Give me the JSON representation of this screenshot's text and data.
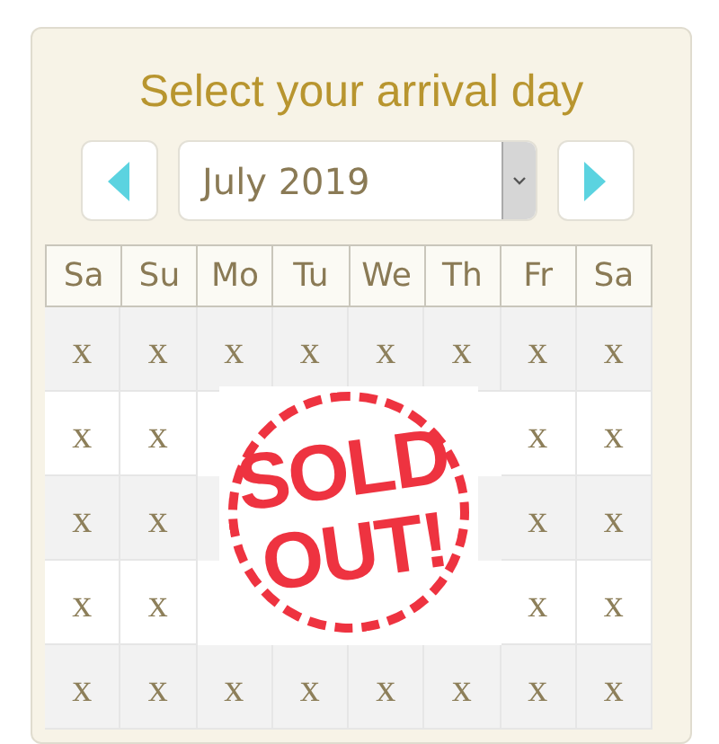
{
  "title": "Select your arrival day",
  "month_picker": {
    "value": "July 2019"
  },
  "weekdays": [
    "Sa",
    "Su",
    "Mo",
    "Tu",
    "We",
    "Th",
    "Fr",
    "Sa"
  ],
  "rows": [
    {
      "kind": "full",
      "cells": [
        "x",
        "x",
        "x",
        "x",
        "x",
        "x",
        "x",
        "x"
      ]
    },
    {
      "kind": "split",
      "cells": [
        "x",
        "x",
        "x",
        "x"
      ]
    },
    {
      "kind": "split",
      "cells": [
        "x",
        "x",
        "x",
        "x"
      ]
    },
    {
      "kind": "split",
      "cells": [
        "x",
        "x",
        "x",
        "x"
      ]
    },
    {
      "kind": "full",
      "cells": [
        "x",
        "x",
        "x",
        "x",
        "x",
        "x",
        "x",
        "x"
      ]
    }
  ],
  "stamp": {
    "lines": [
      "SOLD",
      "OUT!"
    ]
  }
}
